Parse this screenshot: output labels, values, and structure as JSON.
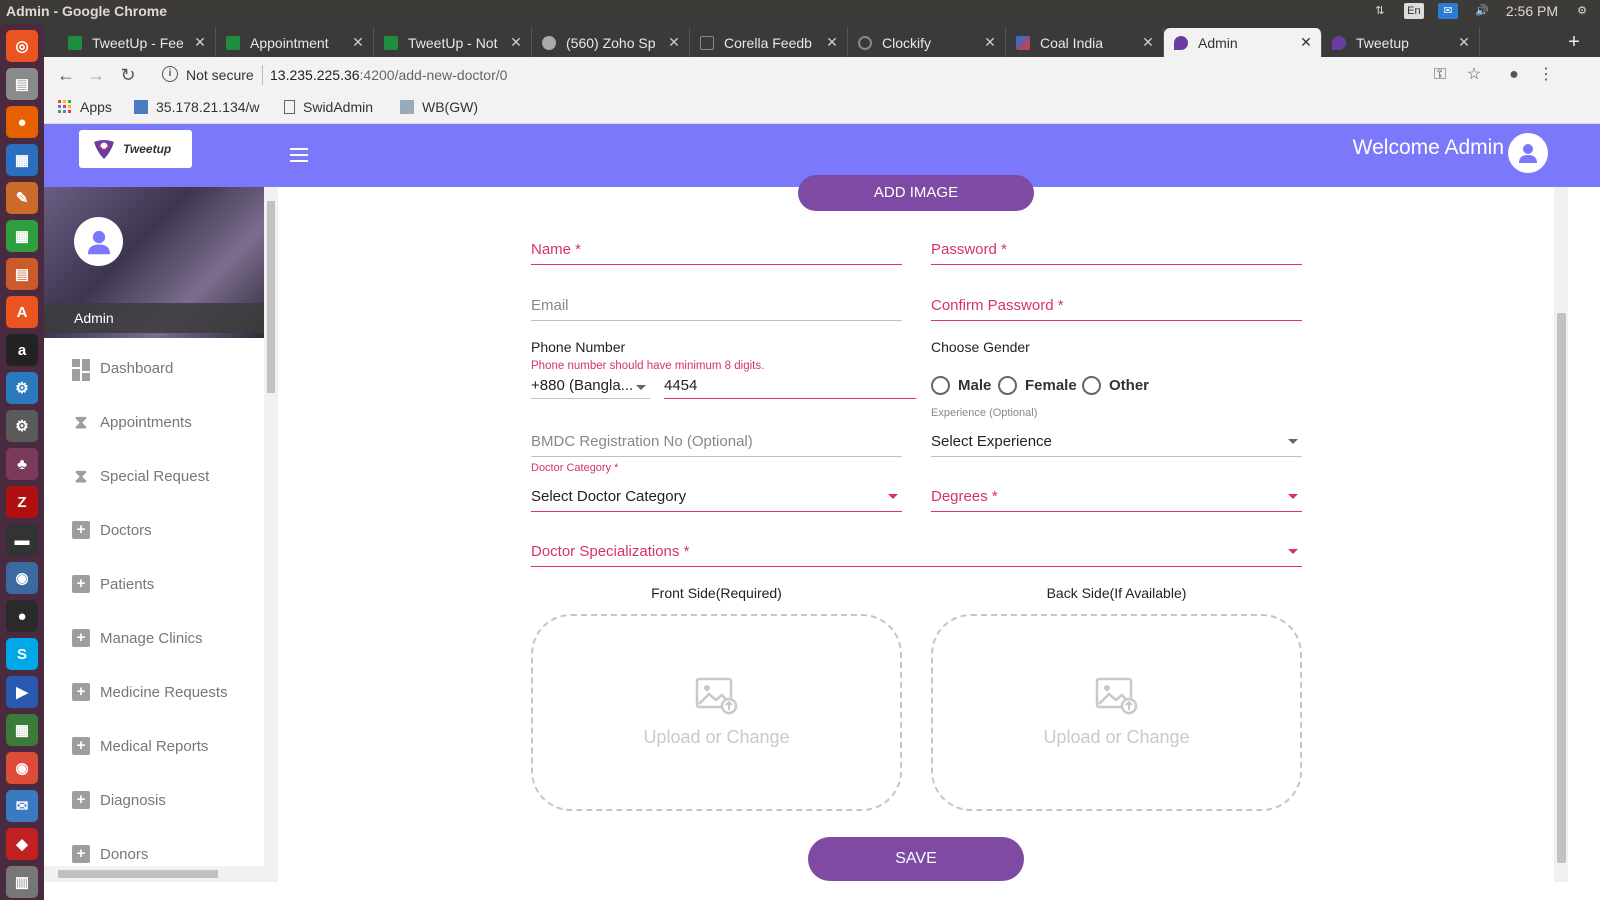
{
  "os": {
    "window_title": "Admin - Google Chrome",
    "lang": "En",
    "time": "2:56 PM"
  },
  "tabs": [
    {
      "label": "TweetUp - Fee",
      "color": "#1e8e3e"
    },
    {
      "label": "Appointment",
      "color": "#1e8e3e"
    },
    {
      "label": "TweetUp - Not",
      "color": "#1e8e3e"
    },
    {
      "label": "(560) Zoho Sp",
      "color": "#aaaaaa"
    },
    {
      "label": "Corella Feedb",
      "color": "#666666"
    },
    {
      "label": "Clockify",
      "color": "#888888"
    },
    {
      "label": "Coal India",
      "color": "#1a73e8"
    },
    {
      "label": "Admin",
      "color": "#6a3ea1"
    },
    {
      "label": "Tweetup",
      "color": "#6a3ea1"
    }
  ],
  "address": {
    "security": "Not secure",
    "host": "13.235.225.36",
    "path": ":4200/add-new-doctor/0"
  },
  "bookmarks": [
    {
      "label": "Apps"
    },
    {
      "label": "35.178.21.134/w"
    },
    {
      "label": "SwidAdmin"
    },
    {
      "label": "WB(GW)"
    }
  ],
  "header": {
    "logo_text": "Tweetup",
    "welcome": "Welcome Admin"
  },
  "sidebar": {
    "profile_name": "Admin",
    "items": [
      {
        "label": "Dashboard",
        "icon": "dashboard-icon"
      },
      {
        "label": "Appointments",
        "icon": "hourglass-icon"
      },
      {
        "label": "Special Request",
        "icon": "hourglass-icon"
      },
      {
        "label": "Doctors",
        "icon": "plus-box-icon"
      },
      {
        "label": "Patients",
        "icon": "plus-box-icon"
      },
      {
        "label": "Manage Clinics",
        "icon": "plus-box-icon"
      },
      {
        "label": "Medicine Requests",
        "icon": "plus-box-icon"
      },
      {
        "label": "Medical Reports",
        "icon": "plus-box-icon"
      },
      {
        "label": "Diagnosis",
        "icon": "plus-box-icon"
      },
      {
        "label": "Donors",
        "icon": "plus-box-icon"
      }
    ]
  },
  "form": {
    "add_image": "ADD IMAGE",
    "name_label": "Name *",
    "password_label": "Password *",
    "email_label": "Email",
    "confirm_password_label": "Confirm Password *",
    "phone_label": "Phone Number",
    "phone_error": "Phone number should have minimum 8 digits.",
    "phone_code": "+880 (Bangla...",
    "phone_value": "4454",
    "gender_label": "Choose Gender",
    "gender_options": [
      "Male",
      "Female",
      "Other"
    ],
    "bmdc_label": "BMDC Registration No (Optional)",
    "experience_label": "Experience (Optional)",
    "experience_value": "Select Experience",
    "category_label": "Doctor Category *",
    "category_value": "Select Doctor Category",
    "degrees_label": "Degrees *",
    "specializations_label": "Doctor Specializations *",
    "front_title": "Front Side(Required)",
    "back_title": "Back Side(If Available)",
    "upload_text": "Upload or Change",
    "save": "SAVE"
  },
  "colors": {
    "header_bg": "#7b78fb",
    "button_bg": "#7e4aa3",
    "error": "#d6336c"
  }
}
